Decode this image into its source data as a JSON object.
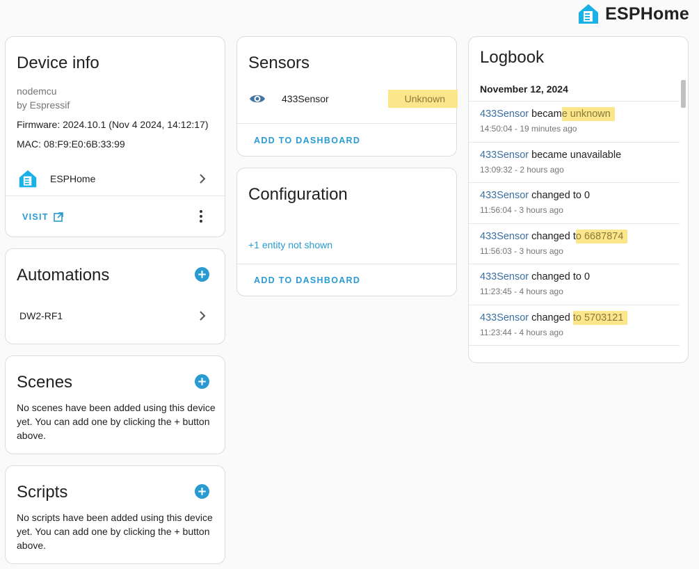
{
  "brand": {
    "name": "ESPHome"
  },
  "device_info": {
    "title": "Device info",
    "model": "nodemcu",
    "manufacturer": "by Espressif",
    "firmware": "Firmware: 2024.10.1 (Nov 4 2024, 14:12:17)",
    "mac": "MAC: 08:F9:E0:6B:33:99",
    "integration": "ESPHome",
    "visit_label": "VISIT"
  },
  "automations": {
    "title": "Automations",
    "items": [
      {
        "label": "DW2-RF1"
      }
    ]
  },
  "scenes": {
    "title": "Scenes",
    "empty_text": "No scenes have been added using this device yet. You can add one by clicking the + button above."
  },
  "scripts": {
    "title": "Scripts",
    "empty_text": "No scripts have been added using this device yet. You can add one by clicking the + button above."
  },
  "sensors": {
    "title": "Sensors",
    "entity_name": "433Sensor",
    "entity_state": "Unknown",
    "add_to_dashboard": "ADD TO DASHBOARD"
  },
  "configuration": {
    "title": "Configuration",
    "hidden_entities": "+1 entity not shown",
    "add_to_dashboard": "ADD TO DASHBOARD"
  },
  "logbook": {
    "title": "Logbook",
    "date": "November 12, 2024",
    "entries": [
      {
        "entity": "433Sensor",
        "pre": " becam",
        "hl": "e unknown",
        "post": "",
        "time": "14:50:04 - 19 minutes ago"
      },
      {
        "entity": "433Sensor",
        "pre": " became unavailable",
        "hl": "",
        "post": "",
        "time": "13:09:32 - 2 hours ago"
      },
      {
        "entity": "433Sensor",
        "pre": " changed to 0",
        "hl": "",
        "post": "",
        "time": "11:56:04 - 3 hours ago"
      },
      {
        "entity": "433Sensor",
        "pre": " changed t",
        "hl": "o 6687874",
        "post": "",
        "time": "11:56:03 - 3 hours ago"
      },
      {
        "entity": "433Sensor",
        "pre": " changed to 0",
        "hl": "",
        "post": "",
        "time": "11:23:45 - 4 hours ago"
      },
      {
        "entity": "433Sensor",
        "pre": " changed ",
        "hl": "to 5703121",
        "post": "",
        "time": "11:23:44 - 4 hours ago"
      }
    ]
  },
  "colors": {
    "accent": "#2a9bd2",
    "highlight": "#fbe68b",
    "entity_link": "#3b6fa3"
  }
}
